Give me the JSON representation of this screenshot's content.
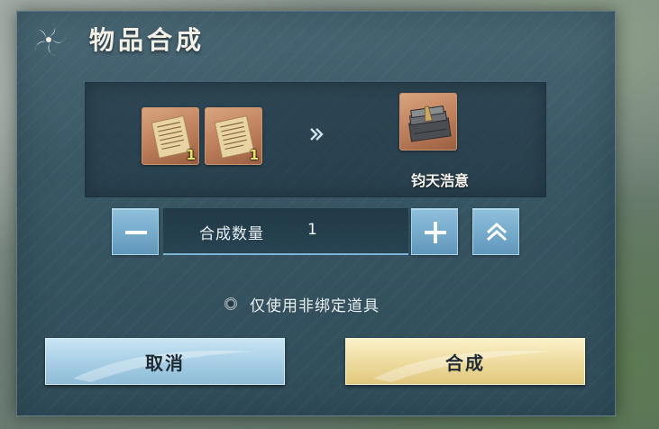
{
  "dialog": {
    "title": "物品合成"
  },
  "recipe": {
    "materials": [
      {
        "icon": "scroll-icon",
        "count": "1"
      },
      {
        "icon": "scroll-icon",
        "count": "1"
      }
    ],
    "arrow_icon": "double-chevron-right-icon",
    "result": {
      "icon": "weapon-case-icon",
      "name": "钧天浩意"
    }
  },
  "quantity": {
    "label": "合成数量",
    "value": "1",
    "decrease_icon": "minus-icon",
    "increase_icon": "plus-icon",
    "max_icon": "double-chevron-up-icon"
  },
  "option": {
    "label": "仅使用非绑定道具"
  },
  "buttons": {
    "cancel_label": "取消",
    "confirm_label": "合成"
  },
  "colors": {
    "cancel_button": "#a8cfe6",
    "confirm_button": "#eedca0",
    "dialog_bg": "#365462",
    "count_text": "#e8e26a"
  }
}
